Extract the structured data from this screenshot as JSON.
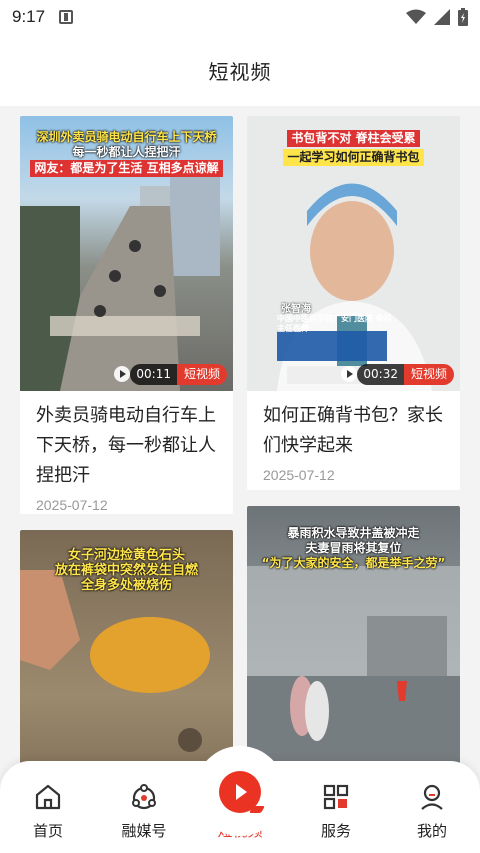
{
  "status_bar": {
    "time": "9:17"
  },
  "header": {
    "title": "短视频"
  },
  "cards": [
    {
      "banner_line1": "深圳外卖员骑电动自行车上下天桥",
      "banner_line2": "每一秒都让人捏把汗",
      "banner_line3": "网友：都是为了生活 互相多点谅解",
      "duration": "00:11",
      "tag": "短视频",
      "title": "外卖员骑电动自行车上下天桥，每一秒都让人捏把汗",
      "date": "2025-07-12"
    },
    {
      "banner_line1": "书包背不对 脊柱会受累",
      "banner_line2": "一起学习如何正确背书包",
      "caption_name": "张智海",
      "caption_org": "中国中医科学院广安门医院 骨科主任医师",
      "duration": "00:32",
      "tag": "短视频",
      "title": "如何正确背书包？家长们快学起来",
      "date": "2025-07-12"
    },
    {
      "banner_line1": "女子河边捡黄色石头",
      "banner_line2": "放在裤袋中突然发生自燃",
      "banner_line3": "全身多处被烧伤"
    },
    {
      "banner_line1": "暴雨积水导致井盖被冲走",
      "banner_line2": "夫妻冒雨将其复位",
      "banner_line3": "“为了大家的安全，都是举手之劳”"
    }
  ],
  "bottom_nav": {
    "items": [
      {
        "label": "首页",
        "icon": "home-icon"
      },
      {
        "label": "融媒号",
        "icon": "media-icon"
      },
      {
        "label": "短视频",
        "icon": "short-video-icon",
        "active": true
      },
      {
        "label": "服务",
        "icon": "grid-icon"
      },
      {
        "label": "我的",
        "icon": "profile-icon"
      }
    ]
  },
  "colors": {
    "accent": "#e23b2e",
    "background": "#f3f3f3"
  }
}
